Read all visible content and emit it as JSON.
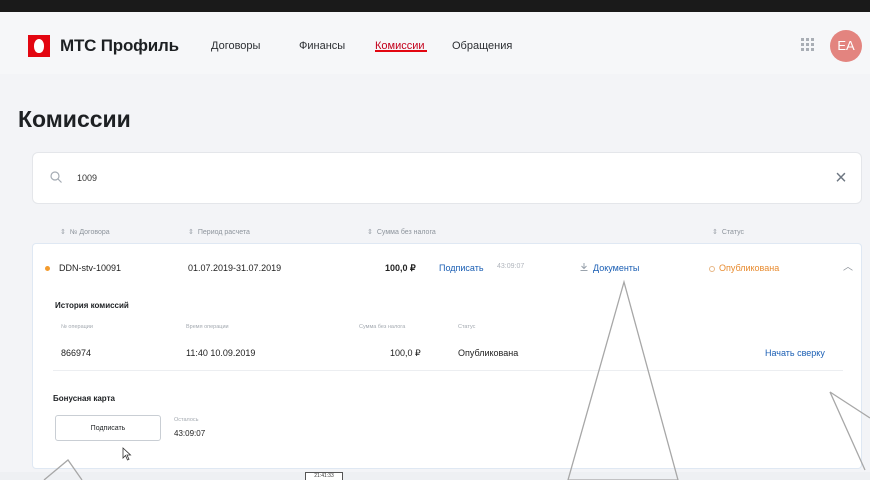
{
  "app": {
    "logo_text": "МТС Профиль",
    "brand_color": "#e30611",
    "avatar_initials": "EA",
    "avatar_color": "#e3847f"
  },
  "nav": {
    "items": [
      {
        "label": "Договоры",
        "active": false
      },
      {
        "label": "Финансы",
        "active": false
      },
      {
        "label": "Комиссии",
        "active": true
      },
      {
        "label": "Обращения",
        "active": false
      }
    ]
  },
  "page": {
    "title": "Комиссии"
  },
  "search": {
    "value": "1009",
    "placeholder": ""
  },
  "table": {
    "headers": [
      "№ Договора",
      "Период расчета",
      "Сумма без налога",
      "Статус"
    ],
    "row": {
      "contract": "DDN-stv-10091",
      "period": "01.07.2019-31.07.2019",
      "amount": "100,0 ₽",
      "sign_link": "Подписать",
      "timer_faded": "43:09:07",
      "documents_link": "Документы",
      "status": "Опубликована",
      "status_color": "#e88b2f"
    }
  },
  "history": {
    "title": "История комиссий",
    "headers": [
      "№ операции",
      "Время операции",
      "Сумма без налога",
      "Статус"
    ],
    "row": {
      "operation_id": "866974",
      "time": "11:40 10.09.2019",
      "amount": "100,0 ₽",
      "status": "Опубликована",
      "action_link": "Начать сверку"
    }
  },
  "bonus": {
    "title": "Бонусная карта",
    "button_label": "Подписать",
    "remaining_label": "Осталось",
    "remaining_value": "43:09:07"
  },
  "footer": {
    "time_badge": "21:41:33"
  },
  "icons": {
    "apps": "grid-icon",
    "search": "search-icon",
    "clear": "close-icon",
    "documents": "download-icon",
    "expand": "chevron-up-icon",
    "cursor": "hand-pointer-icon"
  }
}
